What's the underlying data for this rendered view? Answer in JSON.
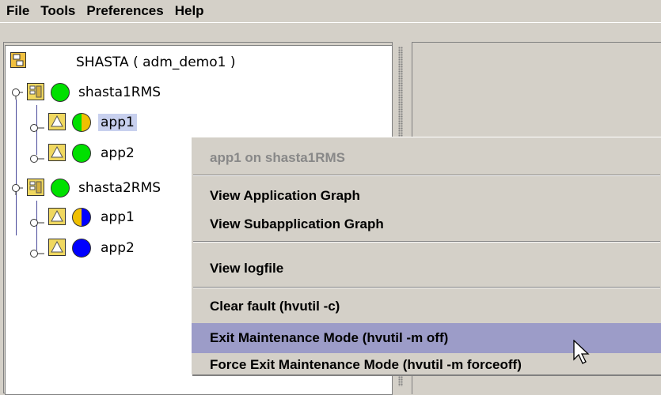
{
  "menubar": {
    "items": [
      "File",
      "Tools",
      "Preferences",
      "Help"
    ]
  },
  "tree": {
    "root_label": "SHASTA ( adm_demo1 )",
    "nodes": [
      {
        "label": "shasta1RMS",
        "status": "online",
        "colors": {
          "left": "#00e000",
          "right": "#00e000"
        }
      },
      {
        "label": "app1",
        "status": "partial",
        "colors": {
          "left": "#00e000",
          "right": "#f0c000"
        }
      },
      {
        "label": "app2",
        "status": "online",
        "colors": {
          "left": "#00e000",
          "right": "#00e000"
        }
      },
      {
        "label": "shasta2RMS",
        "status": "online",
        "colors": {
          "left": "#00e000",
          "right": "#00e000"
        }
      },
      {
        "label": "app1",
        "status": "partial",
        "colors": {
          "left": "#f0c000",
          "right": "#0000ff"
        }
      },
      {
        "label": "app2",
        "status": "offline",
        "colors": {
          "left": "#0000ff",
          "right": "#0000ff"
        }
      }
    ]
  },
  "context_menu": {
    "header": "app1 on shasta1RMS",
    "items": {
      "view_app_graph": "View Application Graph",
      "view_subapp_graph": "View Subapplication Graph",
      "view_logfile": "View logfile",
      "clear_fault": "Clear fault (hvutil -c)",
      "exit_maintenance": "Exit Maintenance Mode (hvutil -m off)",
      "force_exit_maintenance": "Force Exit Maintenance Mode (hvutil -m forceoff)"
    },
    "highlight_color": "#9c9cc8"
  }
}
